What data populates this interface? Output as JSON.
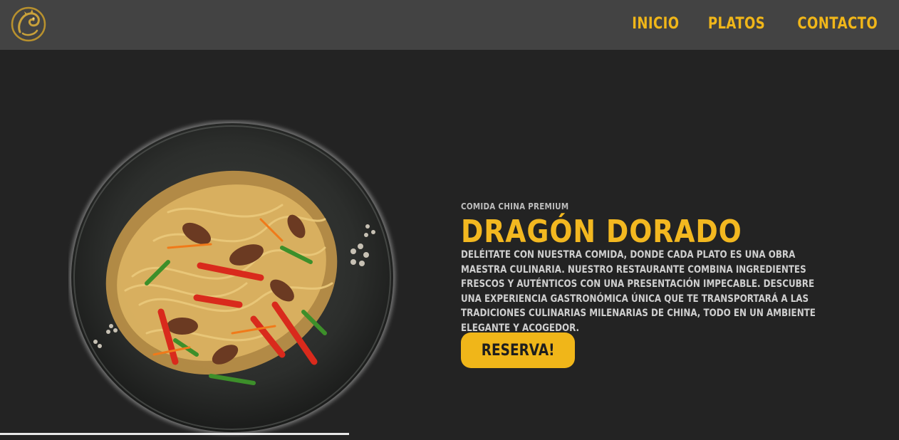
{
  "brand": {
    "logo_icon": "golden-dragon-logo",
    "accent_color": "#f0b619"
  },
  "nav": {
    "items": [
      {
        "label": "INICIO"
      },
      {
        "label": "PLATOS"
      },
      {
        "label": "CONTACTO"
      }
    ]
  },
  "hero": {
    "eyebrow": "COMIDA CHINA PREMIUM",
    "title": "DRAGÓN DORADO",
    "description": "DELÉITATE CON NUESTRA COMIDA, DONDE CADA PLATO ES UNA OBRA MAESTRA CULINARIA. NUESTRO RESTAURANTE COMBINA INGREDIENTES FRESCOS Y AUTÉNTICOS CON UNA PRESENTACIÓN IMPECABLE. DESCUBRE UNA EXPERIENCIA GASTRONÓMICA ÚNICA QUE TE TRANSPORTARÁ A LAS TRADICIONES CULINARIAS MILENARIAS DE CHINA, TODO EN UN AMBIENTE ELEGANTE Y ACOGEDOR.",
    "cta_label": "RESERVA!",
    "image": "stir-fried-noodles-plate"
  }
}
